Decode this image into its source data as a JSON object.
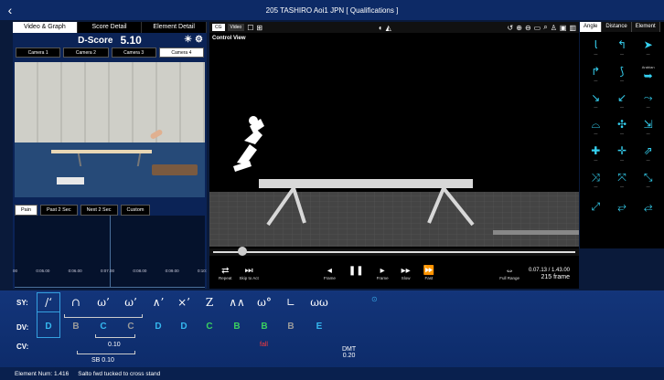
{
  "window": {
    "title": "205 TASHIRO Aoi1 JPN [ Qualifications ]",
    "back_icon": "chevron-left-icon"
  },
  "left": {
    "tabs": [
      "Video & Graph",
      "Score Detail",
      "Element Detail"
    ],
    "active_tab": 0,
    "dscore_label": "D-Score",
    "dscore_value": "5.10",
    "cameras": [
      "Camera 1",
      "Camera 2",
      "Camera 3",
      "Camera 4"
    ],
    "active_camera": 3,
    "section_tabs": [
      "Pain",
      "Past 2 Sec",
      "Next 2 Sec",
      "Custom"
    ],
    "active_section": 0,
    "axis_ticks": [
      "00",
      "0:05.00",
      "0:06.00",
      "0:07.00",
      "0:08.00",
      "0:09.00",
      "0:10:"
    ]
  },
  "center": {
    "toggle_labels": [
      "CG",
      "Video"
    ],
    "active_toggle": 0,
    "view_label": "Control View",
    "controls": {
      "repeat": "Repeat",
      "skip": "Skip to Act",
      "prev_frame": "Frame",
      "next_frame": "Frame",
      "slow": "Slow",
      "fast": "Fast",
      "full_range": "Full Range"
    },
    "time": "0.07.13 / 1.43.00",
    "frames": "215 frame",
    "progress": 0.08
  },
  "right": {
    "tabs": [
      "Angle",
      "Distance",
      "Element"
    ],
    "active_tab": 0,
    "pose_labels": [
      "",
      "",
      "",
      "",
      "",
      "",
      "",
      "",
      "",
      "",
      "",
      "",
      "",
      "",
      "",
      "",
      "",
      "",
      "",
      "",
      ""
    ],
    "highlight_label": "Arabian"
  },
  "bottom": {
    "sy_label": "SY:",
    "dv_label": "DV:",
    "cv_label": "CV:",
    "symbols": [
      "/‘",
      "∩",
      "ω’",
      "ω’",
      "∧’",
      "×’",
      "Z",
      "∧∧",
      "ω°",
      "∟",
      "ωω"
    ],
    "dv": [
      "D",
      "B",
      "C",
      "C",
      "D",
      "D",
      "C",
      "B",
      "B",
      "B",
      "E"
    ],
    "dv_colors": [
      "#35b8f0",
      "#9a9a9a",
      "#35b8f0",
      "#9a9a9a",
      "#35b8f0",
      "#35b8f0",
      "#3ad060",
      "#3ad060",
      "#3ad060",
      "#9a9a9a",
      "#35b8f0"
    ],
    "cv1": "0.10",
    "sb": "SB 0.10",
    "fall": "fall",
    "dmt_label": "DMT",
    "dmt_value": "0.20",
    "element_num": "Element Num: 1.416",
    "element_desc": "Salto fwd tucked to cross stand"
  }
}
